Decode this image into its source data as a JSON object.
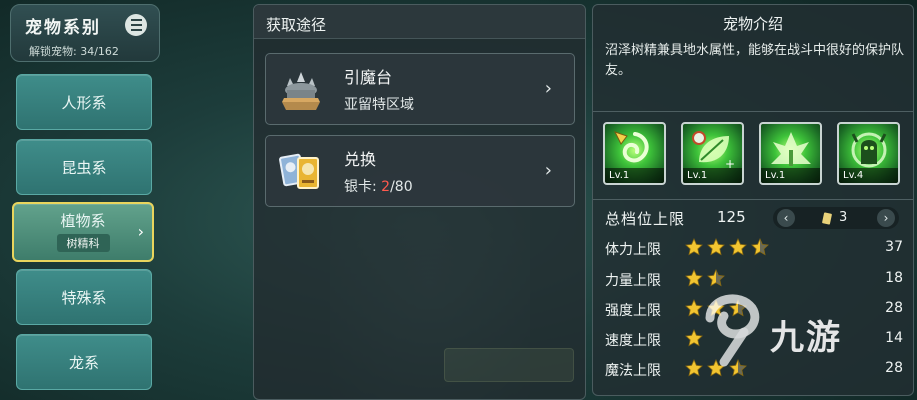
{
  "sidebar": {
    "title": "宠物系别",
    "unlock_label": "解锁宠物: 34/162",
    "categories": [
      {
        "label": "人形系"
      },
      {
        "label": "昆虫系"
      },
      {
        "label": "植物系",
        "sub": "树精科",
        "selected": true
      },
      {
        "label": "特殊系"
      },
      {
        "label": "龙系"
      }
    ]
  },
  "sources": {
    "header": "获取途径",
    "items": [
      {
        "title": "引魔台",
        "subtitle": "亚留特区域",
        "icon": "altar-icon"
      },
      {
        "title": "兑换",
        "subtitle_prefix": "银卡: ",
        "subtitle_current": "2",
        "subtitle_total": "/80",
        "icon": "cards-icon"
      }
    ]
  },
  "pet_info": {
    "header": "宠物介绍",
    "description": "沼泽树精兼具地水属性，能够在战斗中很好的保护队友。",
    "skills": [
      {
        "level": "Lv.1",
        "icon": "nature-swirl-icon"
      },
      {
        "level": "Lv.1",
        "icon": "leaf-heal-icon"
      },
      {
        "level": "Lv.1",
        "icon": "forest-burst-icon"
      },
      {
        "level": "Lv.4",
        "icon": "treant-shield-icon"
      }
    ],
    "tier": {
      "label": "总档位上限",
      "value": "125",
      "page": "3"
    },
    "stats": [
      {
        "label": "体力上限",
        "stars": 3.5,
        "value": "37"
      },
      {
        "label": "力量上限",
        "stars": 1.5,
        "value": "18"
      },
      {
        "label": "强度上限",
        "stars": 2.5,
        "value": "28"
      },
      {
        "label": "速度上限",
        "stars": 1.0,
        "value": "14"
      },
      {
        "label": "魔法上限",
        "stars": 2.5,
        "value": "28"
      }
    ]
  },
  "watermark": {
    "text": "九游"
  },
  "colors": {
    "accent_gold": "#e9d55d",
    "star": "#f2c531",
    "red_count": "#ff5a4e",
    "teal_button": "#3f8d8a"
  }
}
